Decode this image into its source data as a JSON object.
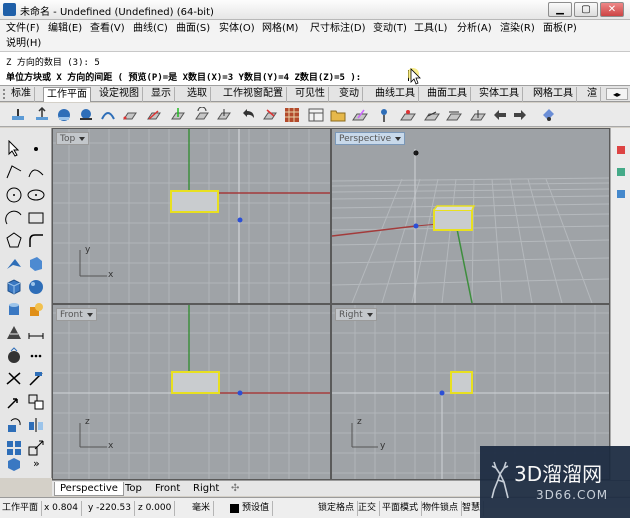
{
  "window": {
    "title": "未命名 - Undefined (Undefined) (64-bit)",
    "minimize": "▁",
    "maximize": "▢",
    "close": "✕"
  },
  "menu": {
    "items": [
      "文件(F)",
      "编辑(E)",
      "查看(V)",
      "曲线(C)",
      "曲面(S)",
      "实体(O)",
      "网格(M)",
      "尺寸标注(D)",
      "变动(T)",
      "工具(L)",
      "分析(A)",
      "渲染(R)",
      "面板(P)"
    ],
    "second_row": [
      "说明(H)"
    ]
  },
  "command": {
    "history_line": "Z 方向的数目 (3): 5",
    "prompt_line": "单位方块或 X 方向的间距 ( 预览(P)=是  X数目(X)=3  Y数目(Y)=4  Z数目(Z)=5 ):"
  },
  "tabs": [
    "标准",
    "工作平面",
    "设定视图",
    "显示",
    "选取",
    "工作视窗配置",
    "可见性",
    "变动",
    "曲线工具",
    "曲面工具",
    "实体工具",
    "网格工具",
    "渲"
  ],
  "active_tab": "工作平面",
  "viewports": {
    "top": "Top",
    "perspective": "Perspective",
    "front": "Front",
    "right": "Right",
    "axis_x": "x",
    "axis_y": "y",
    "axis_z": "z"
  },
  "viewport_tabs": [
    "Perspective",
    "Top",
    "Front",
    "Right"
  ],
  "viewport_tab_add": "✣",
  "status": {
    "cplane": "工作平面",
    "x": "x 0.804",
    "y": "y -220.53",
    "z": "z 0.000",
    "unit": "毫米",
    "layer": "预设值",
    "items": [
      "锁定格点",
      "正交",
      "平面模式",
      "物件锁点",
      "智慧"
    ]
  },
  "watermark": {
    "brand": "3D溜溜网",
    "site": "3D66.COM"
  },
  "colors": {
    "viewport_bg": "#9fa3a7",
    "grid": "#b2b6ba",
    "x_axis": "#a33b3b",
    "y_axis": "#3e8e3e",
    "selection": "#e8e020"
  }
}
